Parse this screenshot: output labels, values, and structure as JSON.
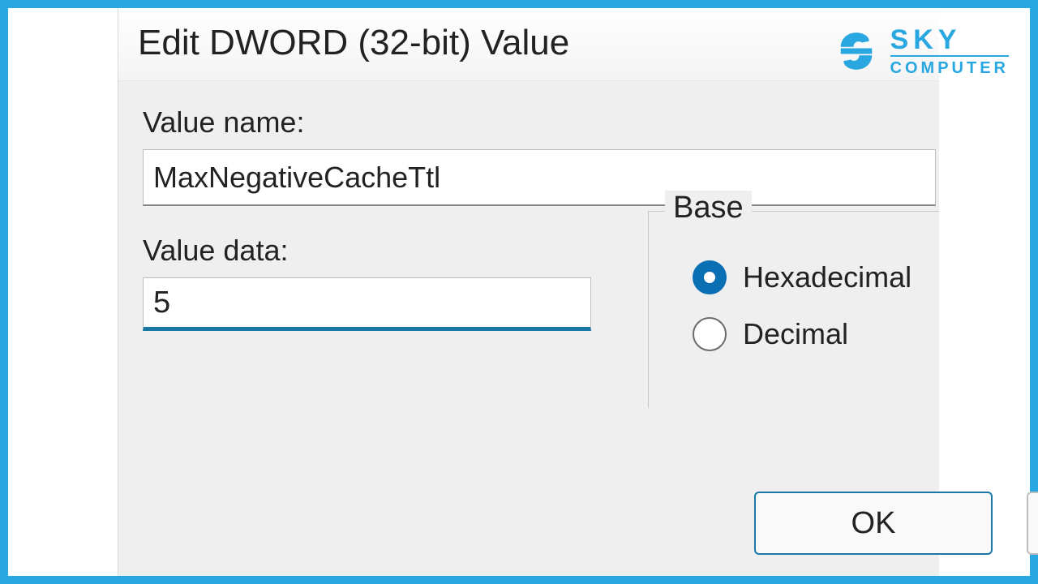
{
  "dialog": {
    "title": "Edit DWORD (32-bit) Value",
    "value_name_label": "Value name:",
    "value_name": "MaxNegativeCacheTtl",
    "value_data_label": "Value data:",
    "value_data": "5",
    "base": {
      "legend": "Base",
      "options": [
        {
          "label": "Hexadecimal",
          "selected": true
        },
        {
          "label": "Decimal",
          "selected": false
        }
      ]
    },
    "ok_label": "OK"
  },
  "branding": {
    "line1": "SKY",
    "line2": "COMPUTER",
    "accent_color": "#28a7e0"
  }
}
